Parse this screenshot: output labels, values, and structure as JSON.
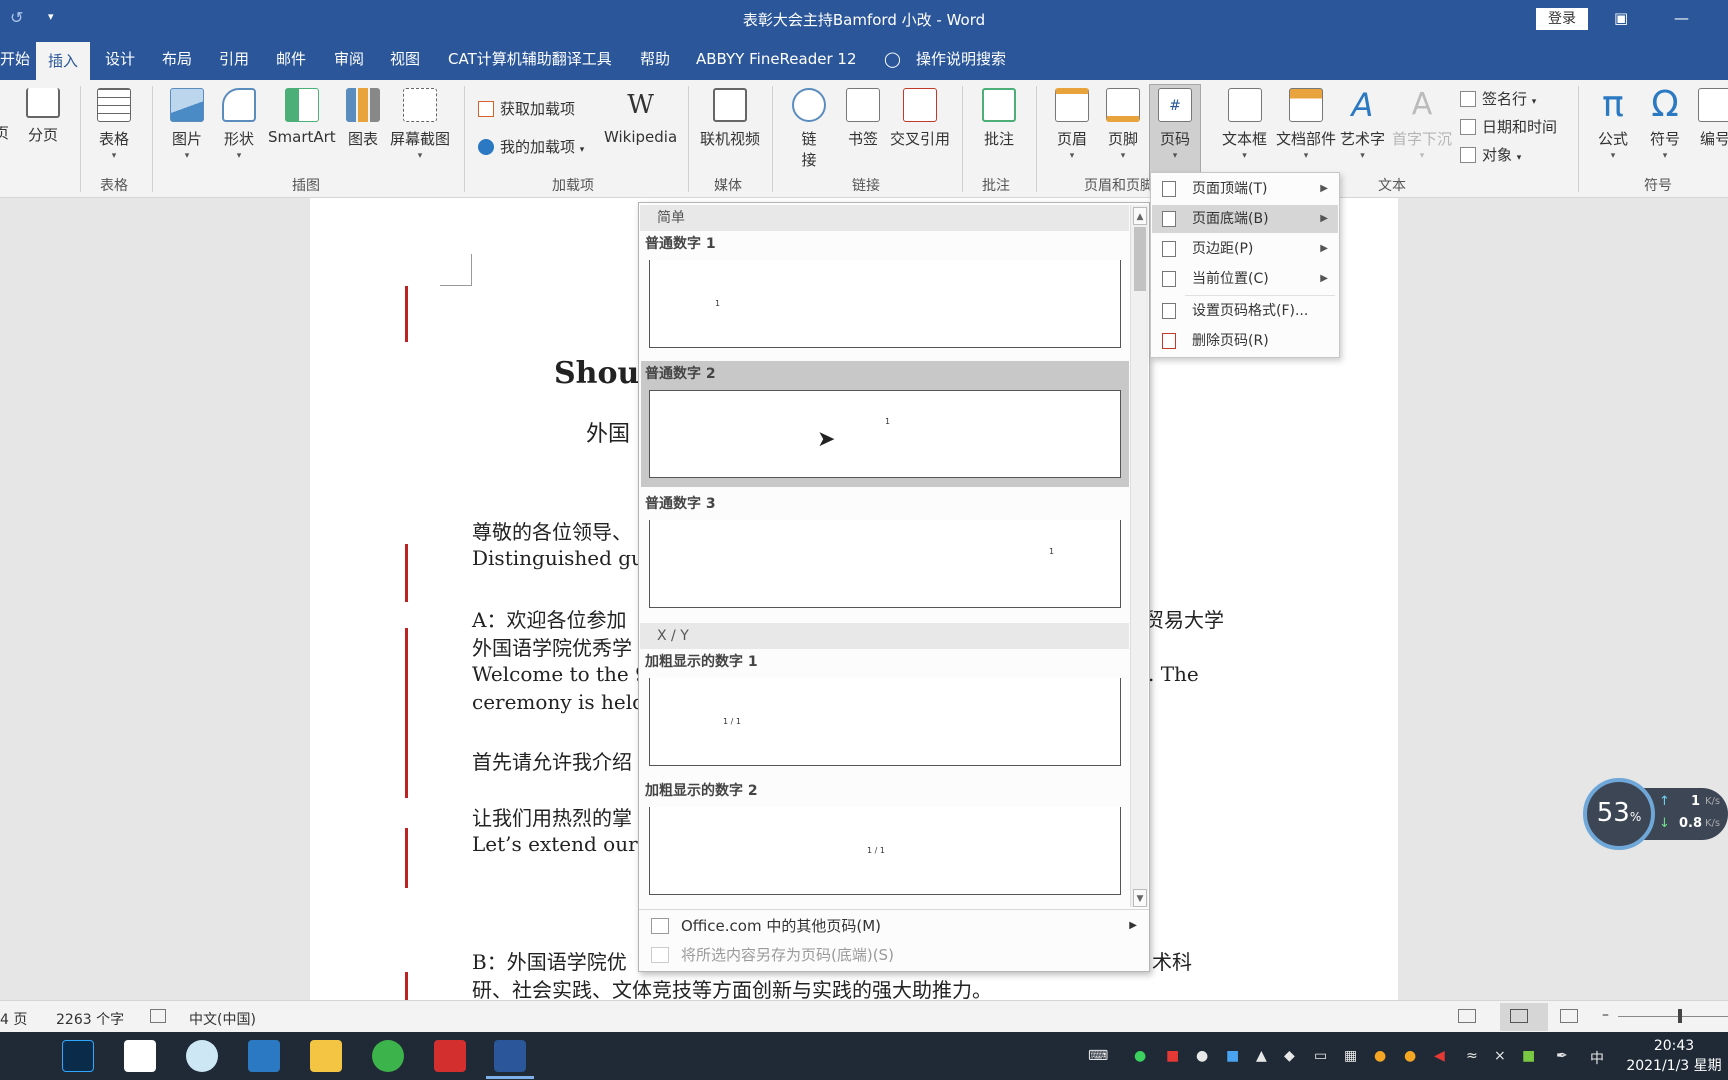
{
  "titlebar": {
    "title": "表彰大会主持Bamford 小改  -  Word",
    "login": "登录"
  },
  "tabs": [
    "开始",
    "插入",
    "设计",
    "布局",
    "引用",
    "邮件",
    "审阅",
    "视图",
    "CAT计算机辅助翻译工具",
    "帮助",
    "ABBYY FineReader 12",
    "操作说明搜索"
  ],
  "ribbon": {
    "pages": {
      "blank": "页",
      "break": "分页"
    },
    "table": {
      "label": "表格",
      "group": "表格"
    },
    "illustrations": {
      "picture": "图片",
      "shapes": "形状",
      "smartart": "SmartArt",
      "chart": "图表",
      "screenshot": "屏幕截图",
      "group": "插图"
    },
    "addins": {
      "get": "获取加载项",
      "mine": "我的加载项",
      "wikipedia": "Wikipedia",
      "group": "加载项"
    },
    "media": {
      "video": "联机视频",
      "group": "媒体"
    },
    "links": {
      "link_a": "链",
      "link_b": "接",
      "bookmark": "书签",
      "crossref": "交叉引用",
      "group": "链接"
    },
    "comments": {
      "comment": "批注",
      "group": "批注"
    },
    "headerfooter": {
      "header": "页眉",
      "footer": "页脚",
      "pagenum": "页码",
      "group": "页眉和页脚"
    },
    "text": {
      "textbox": "文本框",
      "parts": "文档部件",
      "wordart": "艺术字",
      "dropcap": "首字下沉",
      "signature": "签名行",
      "datetime": "日期和时间",
      "object": "对象",
      "group": "文本"
    },
    "symbols": {
      "equation": "公式",
      "symbol": "符号",
      "number": "编号",
      "group": "符号"
    }
  },
  "document": {
    "title_part": "Shoul",
    "subtitle_part": "外国",
    "p1a": "尊敬的各位领导、",
    "p1b": "Distinguished gues",
    "p2a": "A：欢迎各位参加",
    "p2a_right": "贸易大学",
    "p2b": "外国语学院优秀学",
    "p2c": "Welcome to the 9th",
    "p2c_right": ". The",
    "p2d": "ceremony is held b",
    "p3": "首先请允许我介绍",
    "p4a": "让我们用热烈的掌",
    "p4b": "Let’s extend our wa",
    "p5a": "B：外国语学院优",
    "p5a_right": "术科",
    "p5b": "研、社会实践、文体竞技等方面创新与实践的强大助推力。"
  },
  "gallery": {
    "section_simple": "简单",
    "items": [
      {
        "label": "普通数字 1",
        "sample": "1"
      },
      {
        "label": "普通数字 2",
        "sample": "1"
      },
      {
        "label": "普通数字 3",
        "sample": "1"
      },
      {
        "label": "加粗显示的数字 1",
        "sample": "1 / 1"
      },
      {
        "label": "加粗显示的数字 2",
        "sample": "1 / 1"
      }
    ],
    "section_xy": "X / Y",
    "more": "Office.com 中的其他页码(M)",
    "save_selection": "将所选内容另存为页码(底端)(S)"
  },
  "submenu": {
    "items": [
      "页面顶端(T)",
      "页面底端(B)",
      "页边距(P)",
      "当前位置(C)",
      "设置页码格式(F)...",
      "删除页码(R)"
    ]
  },
  "statusbar": {
    "page": "4 页",
    "words": "2263 个字",
    "lang": "中文(中国)"
  },
  "speed": {
    "percent": "53",
    "pct_sign": "%",
    "up": "1",
    "up_unit": "K/s",
    "down": "0.8",
    "down_unit": "K/s"
  },
  "taskbar": {
    "ime": "中",
    "time": "20:43",
    "date": "2021/1/3 星期"
  },
  "colors": {
    "word_blue": "#2b579a",
    "ribbon_bg": "#f3f3f3",
    "hover_gray": "#c8c8c8"
  }
}
